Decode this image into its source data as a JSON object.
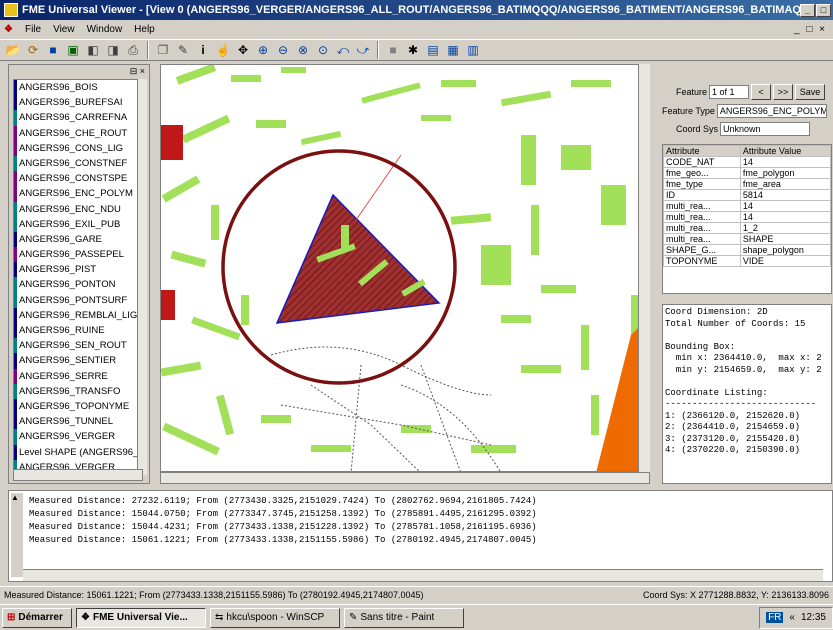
{
  "window": {
    "title": "FME Universal Viewer - [View 0 (ANGERS96_VERGER/ANGERS96_ALL_ROUT/ANGERS96_BATIMQQQ/ANGERS96_BATIMENT/ANGERS96_BATIMAQ/ANGE]"
  },
  "menu": {
    "items": [
      "File",
      "View",
      "Window",
      "Help"
    ]
  },
  "toolbar": {
    "icons": [
      "open-icon",
      "reload-icon",
      "save-icon",
      "import-icon",
      "export-icon",
      "settings-icon",
      "print-icon",
      "copy-icon",
      "measure-icon",
      "info-icon",
      "select-icon",
      "pan-icon",
      "zoom-in-icon",
      "zoom-out-icon",
      "zoom-extents-icon",
      "zoom-selection-icon",
      "back-icon",
      "forward-icon",
      "stop-icon",
      "pin-icon",
      "table-icon",
      "grid-icon",
      "layout-icon"
    ]
  },
  "layers": {
    "items": [
      {
        "label": "ANGERS96_BOIS",
        "color": "#000080"
      },
      {
        "label": "ANGERS96_BUREFSAI",
        "color": "#000080"
      },
      {
        "label": "ANGERS96_CARREFNA",
        "color": "#008080"
      },
      {
        "label": "ANGERS96_CHE_ROUT",
        "color": "#800080"
      },
      {
        "label": "ANGERS96_CONS_LIG",
        "color": "#800080"
      },
      {
        "label": "ANGERS96_CONSTNEF",
        "color": "#008080"
      },
      {
        "label": "ANGERS96_CONSTSPE",
        "color": "#800080"
      },
      {
        "label": "ANGERS96_ENC_POLYM",
        "color": "#800080"
      },
      {
        "label": "ANGERS96_ENC_NDU",
        "color": "#008080"
      },
      {
        "label": "ANGERS96_EXIL_PUB",
        "color": "#008080"
      },
      {
        "label": "ANGERS96_GARE",
        "color": "#000080"
      },
      {
        "label": "ANGERS96_PASSEPEL",
        "color": "#800080"
      },
      {
        "label": "ANGERS96_PIST",
        "color": "#000080"
      },
      {
        "label": "ANGERS96_PONTON",
        "color": "#008080"
      },
      {
        "label": "ANGERS96_PONTSURF",
        "color": "#008080"
      },
      {
        "label": "ANGERS96_REMBLAI_LIG",
        "color": "#000080"
      },
      {
        "label": "ANGERS96_RUINE",
        "color": "#000080"
      },
      {
        "label": "ANGERS96_SEN_ROUT",
        "color": "#008080"
      },
      {
        "label": "ANGERS96_SENTIER",
        "color": "#000080"
      },
      {
        "label": "ANGERS96_SERRE",
        "color": "#800080"
      },
      {
        "label": "ANGERS96_TRANSFO",
        "color": "#008080"
      },
      {
        "label": "ANGERS96_TOPONYME",
        "color": "#000080"
      },
      {
        "label": "ANGERS96_TUNNEL",
        "color": "#000080"
      },
      {
        "label": "ANGERS96_VERGER",
        "color": "#008080"
      },
      {
        "label": "Level SHAPE (ANGERS96_VE",
        "color": "#000080"
      },
      {
        "label": "ANGERS96_VERGER",
        "color": "#008080"
      }
    ]
  },
  "properties": {
    "feature_label": "Feature",
    "feature_value": "1 of 1",
    "save_label": "Save",
    "feature_type_label": "Feature Type",
    "feature_type_value": "ANGERS96_ENC_POLYM",
    "coord_sys_label": "Coord Sys",
    "coord_sys_value": "Unknown",
    "attr_header": [
      "Attribute",
      "Attribute Value"
    ],
    "attributes": [
      [
        "CODE_NAT",
        "14"
      ],
      [
        "fme_geo...",
        "fme_polygon"
      ],
      [
        "fme_type",
        "fme_area"
      ],
      [
        "ID",
        "5814"
      ],
      [
        "multi_rea...",
        "14"
      ],
      [
        "multi_rea...",
        "14"
      ],
      [
        "multi_rea...",
        "1_2"
      ],
      [
        "multi_rea...",
        "SHAPE"
      ],
      [
        "SHAPE_G...",
        "shape_polygon"
      ],
      [
        "TOPONYME",
        "VIDE"
      ]
    ],
    "coord_text": "Coord Dimension: 2D\nTotal Number of Coords: 15\n\nBounding Box:\n  min x: 2364410.0,  max x: 2\n  min y: 2154659.0,  max y: 2\n\nCoordinate Listing:\n----------------------------\n1: (2366120.0, 2152620.0)\n2: (2364410.0, 2154659.0)\n3: (2373120.0, 2155420.0)\n4: (2370220.0, 2150390.0)"
  },
  "log": {
    "lines": [
      "Measured Distance: 27232.6119; From (2773430.3325,2151029.7424) To (2802762.9694,2161805.7424)",
      "Measured Distance: 15044.0750; From (2773347.3745,2151258.1392) To (2785891.4495,2161295.0392)",
      "Measured Distance: 15044.4231; From (2773433.1338,2151228.1392) To (2785781.1058,2161195.6936)",
      "Measured Distance: 15061.1221; From (2773433.1338,2151155.5986) To (2780192.4945,2174807.0045)"
    ]
  },
  "statusbar": {
    "left": "Measured Distance: 15061.1221; From (2773433.1338,2151155.5986) To (2780192.4945,2174807.0045)",
    "right": "Coord Sys: X 2771288.8832, Y: 2136133.8096"
  },
  "taskbar": {
    "start_label": "Démarrer",
    "tasks": [
      "FME Universal Vie...",
      "hkcu\\spoon - WinSCP",
      "Sans titre - Paint"
    ],
    "lang": "FR",
    "clock": "12:35"
  }
}
